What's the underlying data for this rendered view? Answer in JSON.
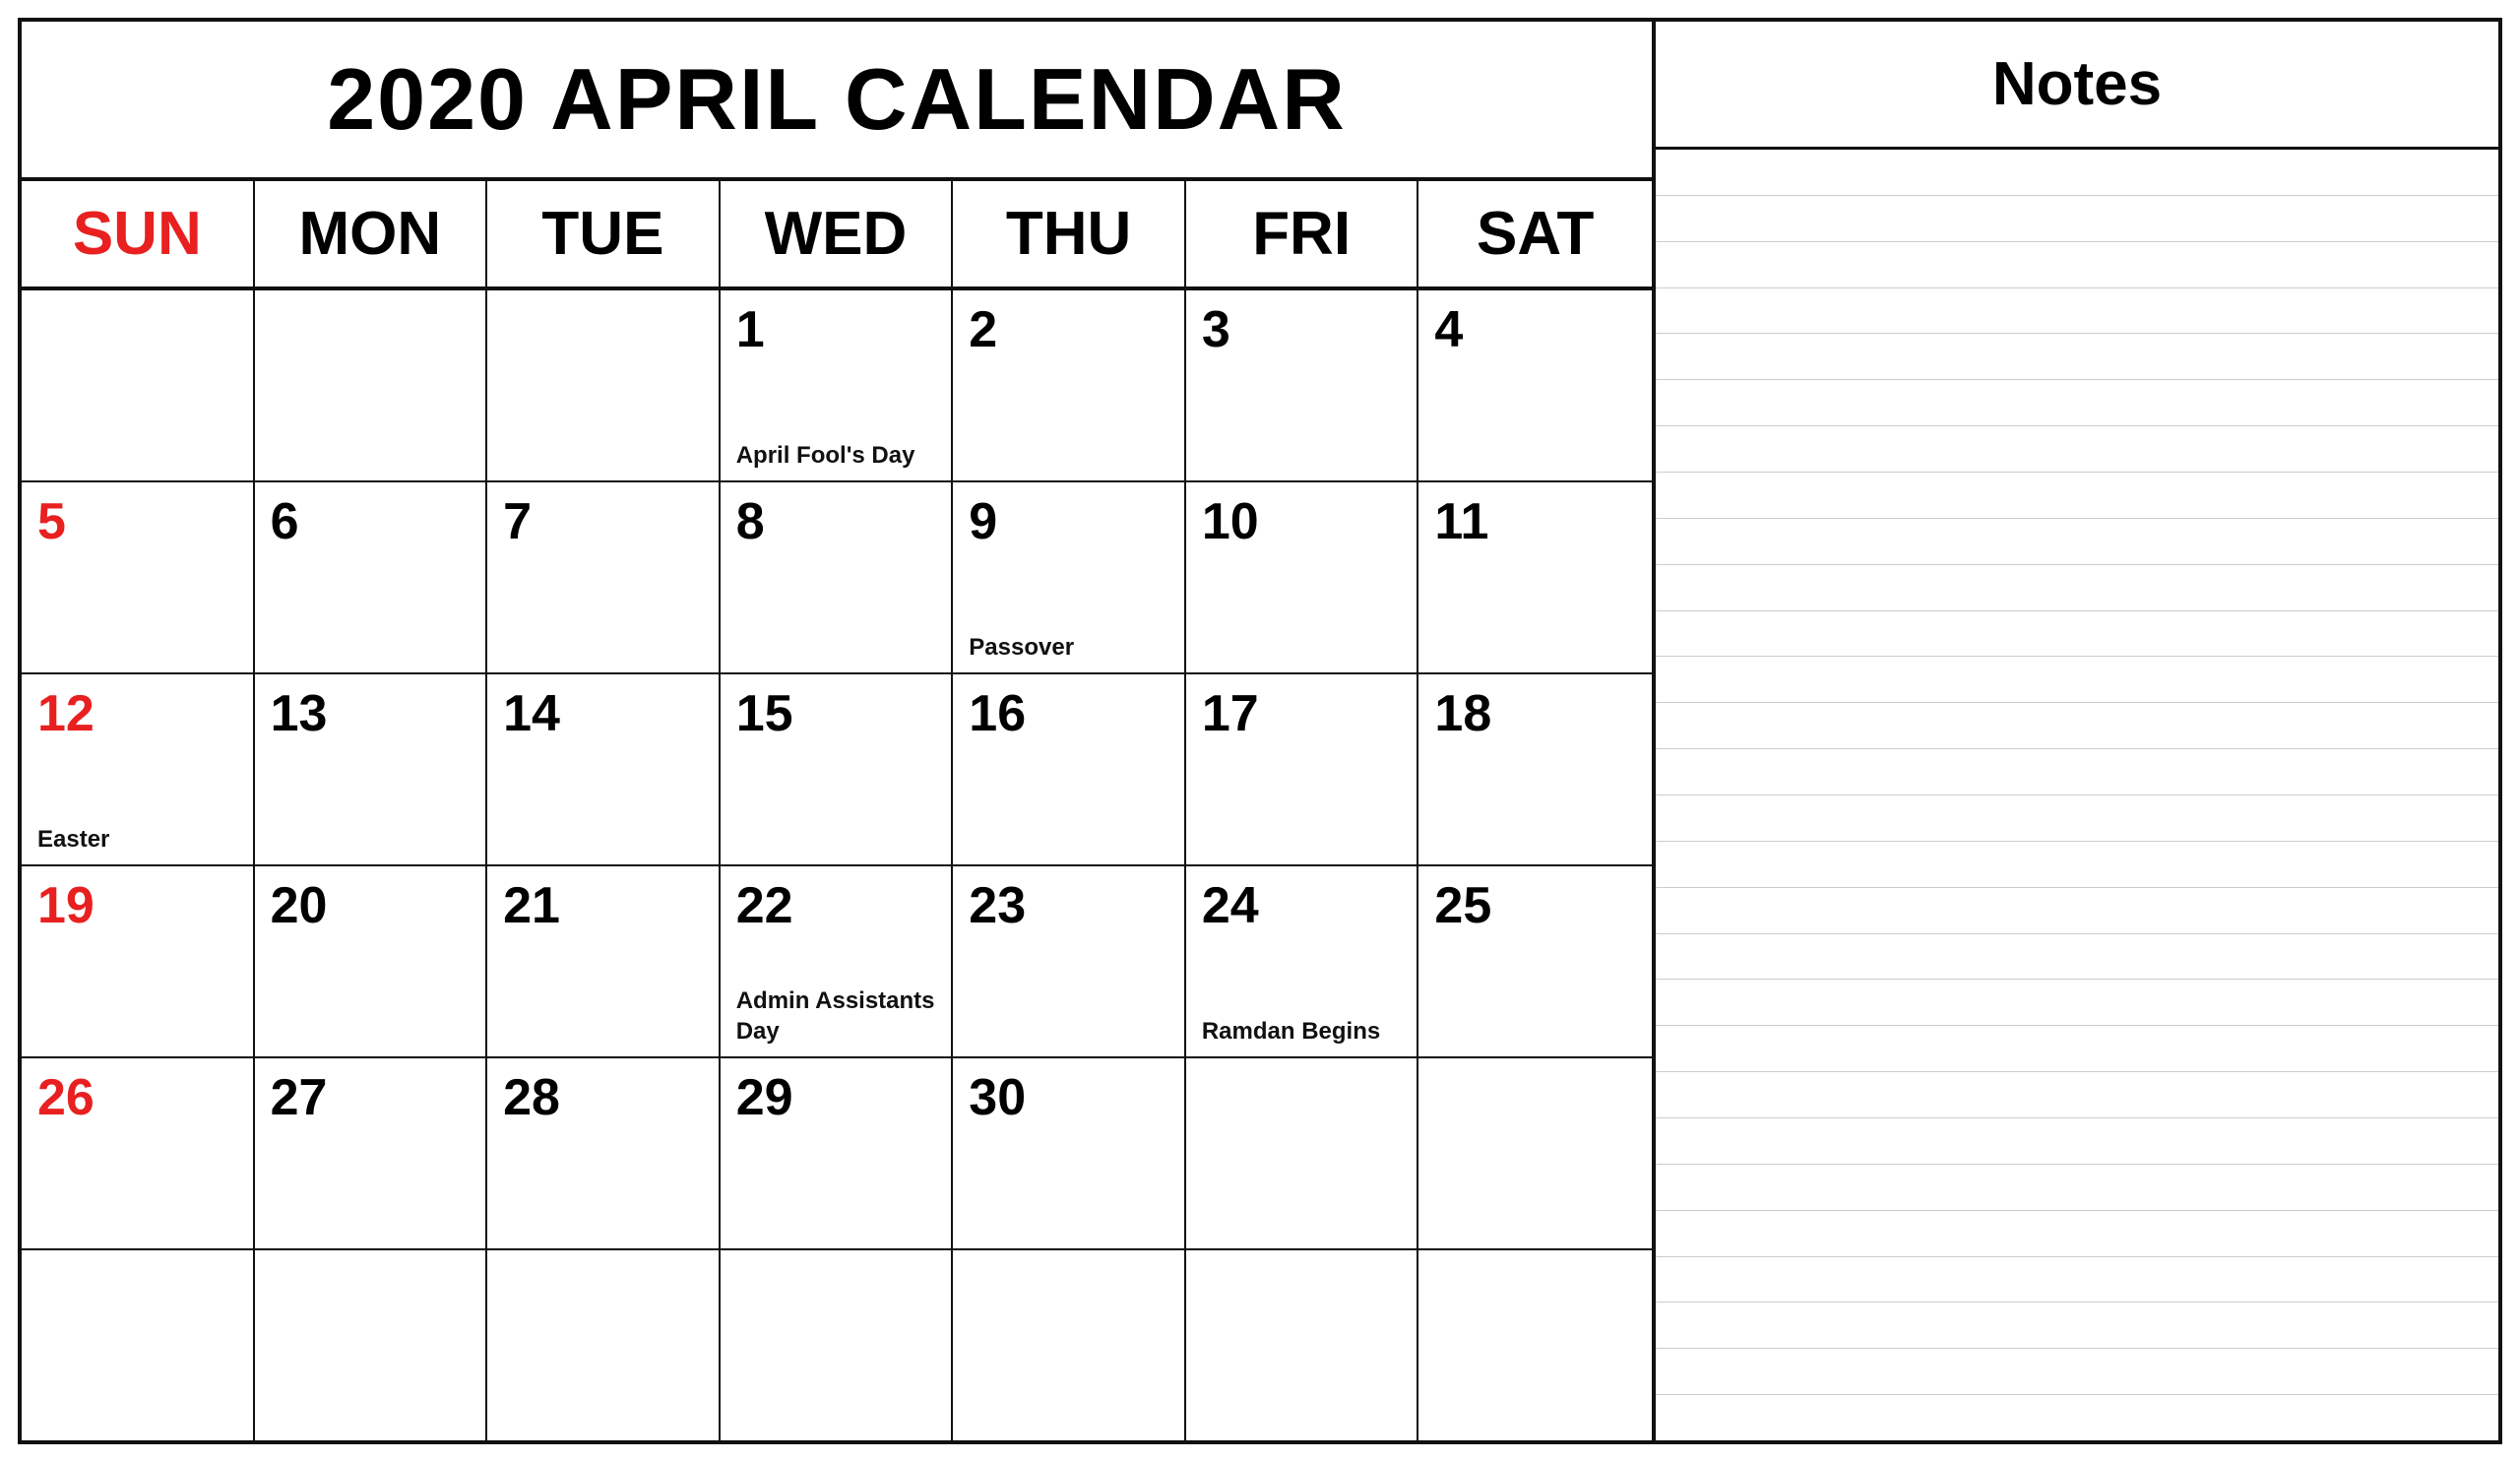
{
  "title": "2020 APRIL CALENDAR",
  "notes_title": "Notes",
  "days_header": [
    "SUN",
    "MON",
    "TUE",
    "WED",
    "THU",
    "FRI",
    "SAT"
  ],
  "weeks": [
    [
      {
        "number": "",
        "event": ""
      },
      {
        "number": "",
        "event": ""
      },
      {
        "number": "",
        "event": ""
      },
      {
        "number": "1",
        "event": "April Fool's Day"
      },
      {
        "number": "2",
        "event": ""
      },
      {
        "number": "3",
        "event": ""
      },
      {
        "number": "4",
        "event": ""
      }
    ],
    [
      {
        "number": "5",
        "event": "",
        "sunday": true
      },
      {
        "number": "6",
        "event": ""
      },
      {
        "number": "7",
        "event": ""
      },
      {
        "number": "8",
        "event": ""
      },
      {
        "number": "9",
        "event": "Passover"
      },
      {
        "number": "10",
        "event": ""
      },
      {
        "number": "11",
        "event": ""
      }
    ],
    [
      {
        "number": "12",
        "event": "Easter",
        "sunday": true
      },
      {
        "number": "13",
        "event": ""
      },
      {
        "number": "14",
        "event": ""
      },
      {
        "number": "15",
        "event": ""
      },
      {
        "number": "16",
        "event": ""
      },
      {
        "number": "17",
        "event": ""
      },
      {
        "number": "18",
        "event": ""
      }
    ],
    [
      {
        "number": "19",
        "event": "",
        "sunday": true
      },
      {
        "number": "20",
        "event": ""
      },
      {
        "number": "21",
        "event": ""
      },
      {
        "number": "22",
        "event": "Admin Assistants Day"
      },
      {
        "number": "23",
        "event": ""
      },
      {
        "number": "24",
        "event": "Ramdan Begins"
      },
      {
        "number": "25",
        "event": ""
      }
    ],
    [
      {
        "number": "26",
        "event": "",
        "sunday": true
      },
      {
        "number": "27",
        "event": ""
      },
      {
        "number": "28",
        "event": ""
      },
      {
        "number": "29",
        "event": ""
      },
      {
        "number": "30",
        "event": ""
      },
      {
        "number": "",
        "event": ""
      },
      {
        "number": "",
        "event": ""
      }
    ],
    [
      {
        "number": "",
        "event": ""
      },
      {
        "number": "",
        "event": ""
      },
      {
        "number": "",
        "event": ""
      },
      {
        "number": "",
        "event": ""
      },
      {
        "number": "",
        "event": ""
      },
      {
        "number": "",
        "event": ""
      },
      {
        "number": "",
        "event": ""
      }
    ]
  ],
  "note_lines_count": 28
}
